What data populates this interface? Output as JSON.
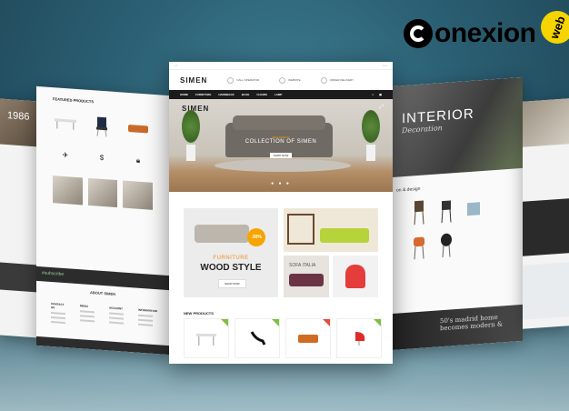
{
  "brand": {
    "name": "onexion",
    "badge": "web",
    "accent_color": "#f5d400"
  },
  "main": {
    "logo": "SIMEN",
    "header_info": [
      {
        "icon": "phone-icon",
        "label": "CALL OPERATOR"
      },
      {
        "icon": "globe-icon",
        "label": "WEBSITE"
      },
      {
        "icon": "truck-icon",
        "label": "ORDER DELIVERY"
      }
    ],
    "nav": [
      "HOME",
      "FURNITURE",
      "HANDBAGS",
      "BLOG",
      "CHAIRS",
      "LAMP"
    ],
    "hero": {
      "brand": "SIMEN",
      "kicker": "NEW DESIGN",
      "title": "COLLECTION OF SIMEN",
      "button": "SHOP NOW",
      "dots": "● ● ●"
    },
    "banner": {
      "discount": "-30%",
      "subtitle": "FURNITURE",
      "title": "WOOD STYLE",
      "button": "SHOP NOW",
      "sofa_label": "SOFA ITALIA"
    },
    "new_products_title": "NEW PRODUCTS",
    "new_products_arrows": "‹ ›"
  },
  "left": {
    "featured_title": "FEATURED PRODUCTS",
    "hero_number": "1986",
    "subscribe": "#subscribe",
    "about_title": "ABOUT SIMEN",
    "footer_cols": [
      "CONTACT US",
      "MENU",
      "ACCOUNT",
      "INFORMATION"
    ]
  },
  "right": {
    "hero_title": "INTERIOR",
    "hero_subtitle": "Decoration",
    "section_title": "on & design",
    "tagline": "50's madrid home becomes modern &"
  }
}
